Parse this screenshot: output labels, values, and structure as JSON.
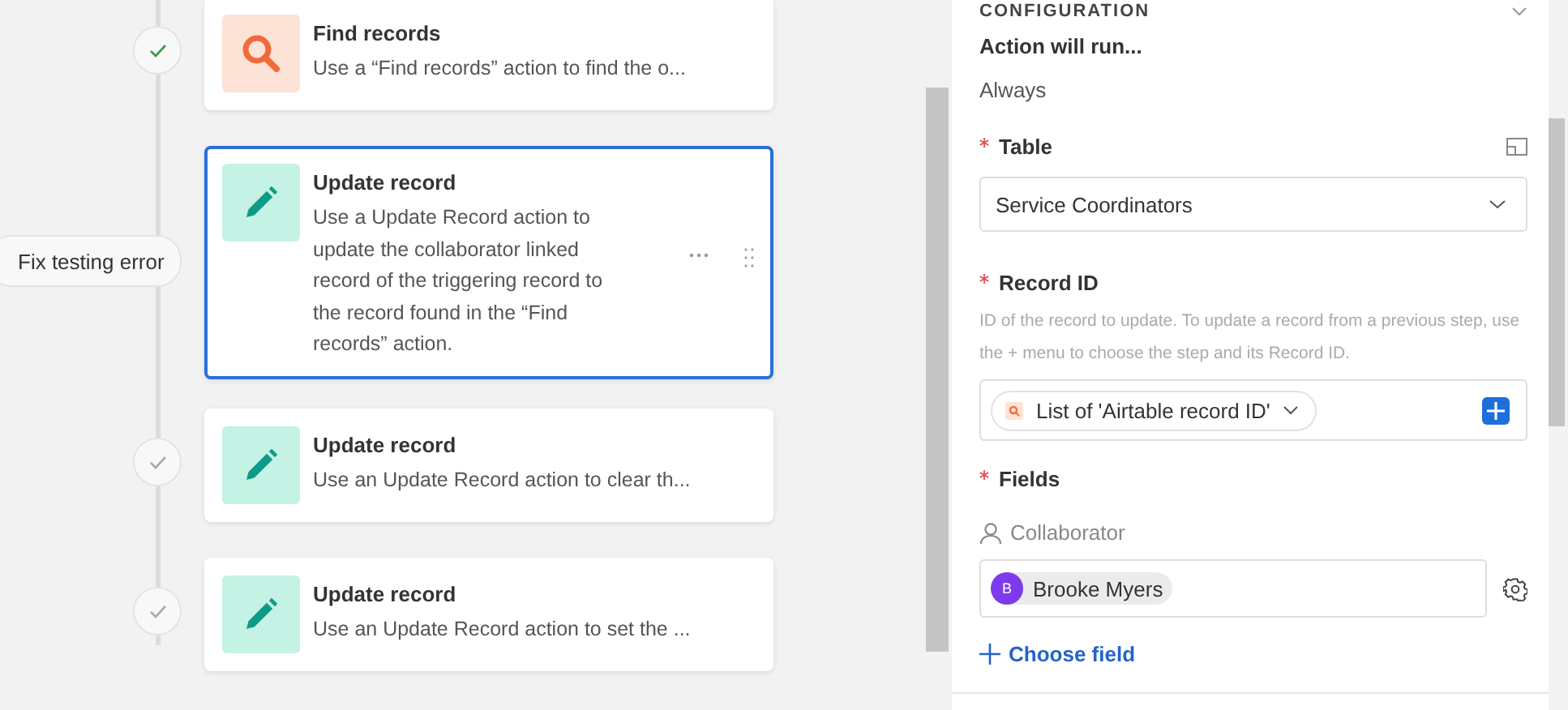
{
  "steps": [
    {
      "kind": "find",
      "title": "Find records",
      "description": "Use a “Find records” action to find the o...",
      "marker": {
        "kind": "check",
        "passed": true
      },
      "selected": false
    },
    {
      "kind": "update",
      "title": "Update record",
      "description": "Use a Update Record action to update the collaborator linked record of the triggering record to the record found in the “Find records” action.",
      "marker": {
        "kind": "error",
        "label": "Fix testing error"
      },
      "selected": true
    },
    {
      "kind": "update",
      "title": "Update record",
      "description": "Use an Update Record action to clear th...",
      "marker": {
        "kind": "check",
        "passed": false
      },
      "selected": false
    },
    {
      "kind": "update",
      "title": "Update record",
      "description": "Use an Update Record action to set the ...",
      "marker": {
        "kind": "check",
        "passed": false
      },
      "selected": false
    }
  ],
  "panel": {
    "section_title": "CONFIGURATION",
    "run_label": "Action will run...",
    "run_value": "Always",
    "table": {
      "label": "Table",
      "required": true,
      "value": "Service Coordinators"
    },
    "record_id": {
      "label": "Record ID",
      "required": true,
      "help": "ID of the record to update. To update a record from a previous step, use the + menu to choose the step and its Record ID.",
      "token": "List of 'Airtable record ID'"
    },
    "fields": {
      "required": true,
      "title": "Fields",
      "items": [
        {
          "name": "Collaborator",
          "value": "Brooke Myers",
          "avatar_letter": "B",
          "color": "#7c3aed"
        }
      ],
      "add_label": "Choose field"
    }
  }
}
